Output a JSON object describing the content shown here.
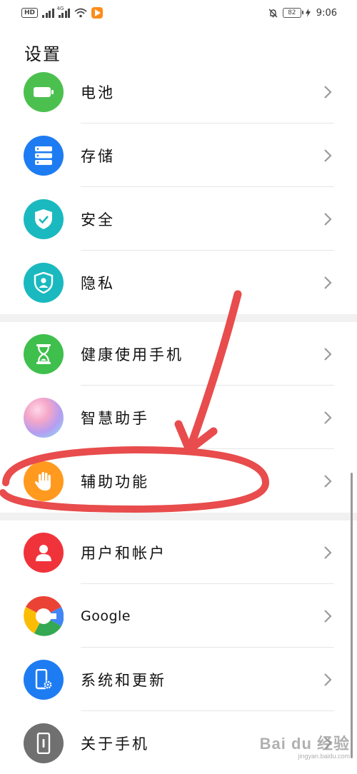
{
  "status_bar": {
    "left_badge": "HD",
    "network_label": "4G",
    "battery": "82",
    "time": "9:06"
  },
  "title": "设置",
  "groups": [
    {
      "items": [
        {
          "label": "电池",
          "icon": "battery-icon",
          "color": "#4cc04f"
        },
        {
          "label": "存储",
          "icon": "storage-icon",
          "color": "#1e7cf2"
        },
        {
          "label": "安全",
          "icon": "shield-check-icon",
          "color": "#1ab9bf"
        },
        {
          "label": "隐私",
          "icon": "privacy-icon",
          "color": "#1ab9bf"
        }
      ]
    },
    {
      "items": [
        {
          "label": "健康使用手机",
          "icon": "hourglass-icon",
          "color": "#3fbf4c"
        },
        {
          "label": "智慧助手",
          "icon": "smart-assistant-icon",
          "color": "#c59ae8"
        },
        {
          "label": "辅助功能",
          "icon": "hand-icon",
          "color": "#ff9a1f"
        }
      ]
    },
    {
      "items": [
        {
          "label": "用户和帐户",
          "icon": "user-icon",
          "color": "#f0333a"
        },
        {
          "label": "Google",
          "icon": "google-icon",
          "color": "#4285f4"
        },
        {
          "label": "系统和更新",
          "icon": "phone-gear-icon",
          "color": "#1e7cf2"
        },
        {
          "label": "关于手机",
          "icon": "phone-info-icon",
          "color": "#707070"
        }
      ]
    }
  ],
  "annotation": {
    "color": "#e84c4c",
    "highlighted_item": "辅助功能"
  },
  "watermark": {
    "logo": "Bai du 经验",
    "sub": "jingyan.baidu.com"
  }
}
